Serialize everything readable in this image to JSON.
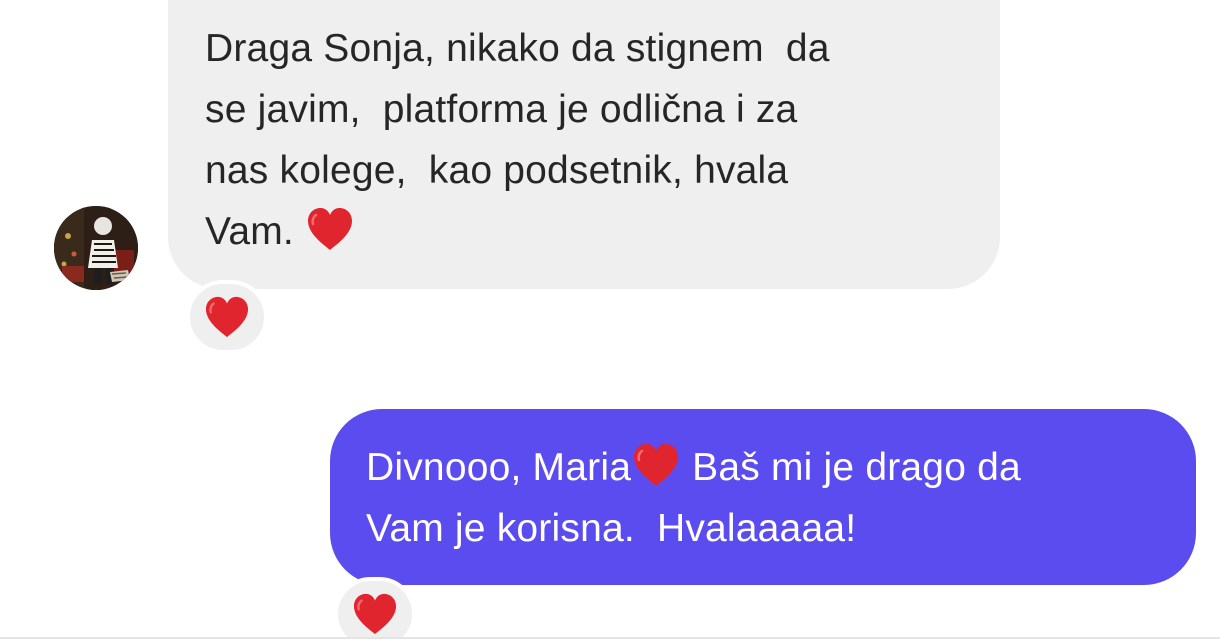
{
  "colors": {
    "incoming_bubble": "#efefef",
    "outgoing_bubble": "#5b4cf0",
    "heart": "#e1252f",
    "incoming_text": "#262626",
    "outgoing_text": "#ffffff"
  },
  "conversation": {
    "incoming_message": {
      "avatar_icon": "user-avatar-photo",
      "lines": [
        "Draga Sonja, nikako da stignem  da",
        "se javim,  platforma je odlična i za",
        "nas kolege,  kao podsetnik, hvala",
        "Vam."
      ],
      "inline_emoji": "red-heart-icon",
      "reaction": "red-heart-icon"
    },
    "outgoing_message": {
      "line1_before": "Divnooo, Maria",
      "line1_after": " Baš mi je drago da",
      "line2": "Vam je korisna.  Hvalaaaaa!",
      "inline_emoji": "red-heart-icon",
      "reaction": "red-heart-icon"
    }
  }
}
